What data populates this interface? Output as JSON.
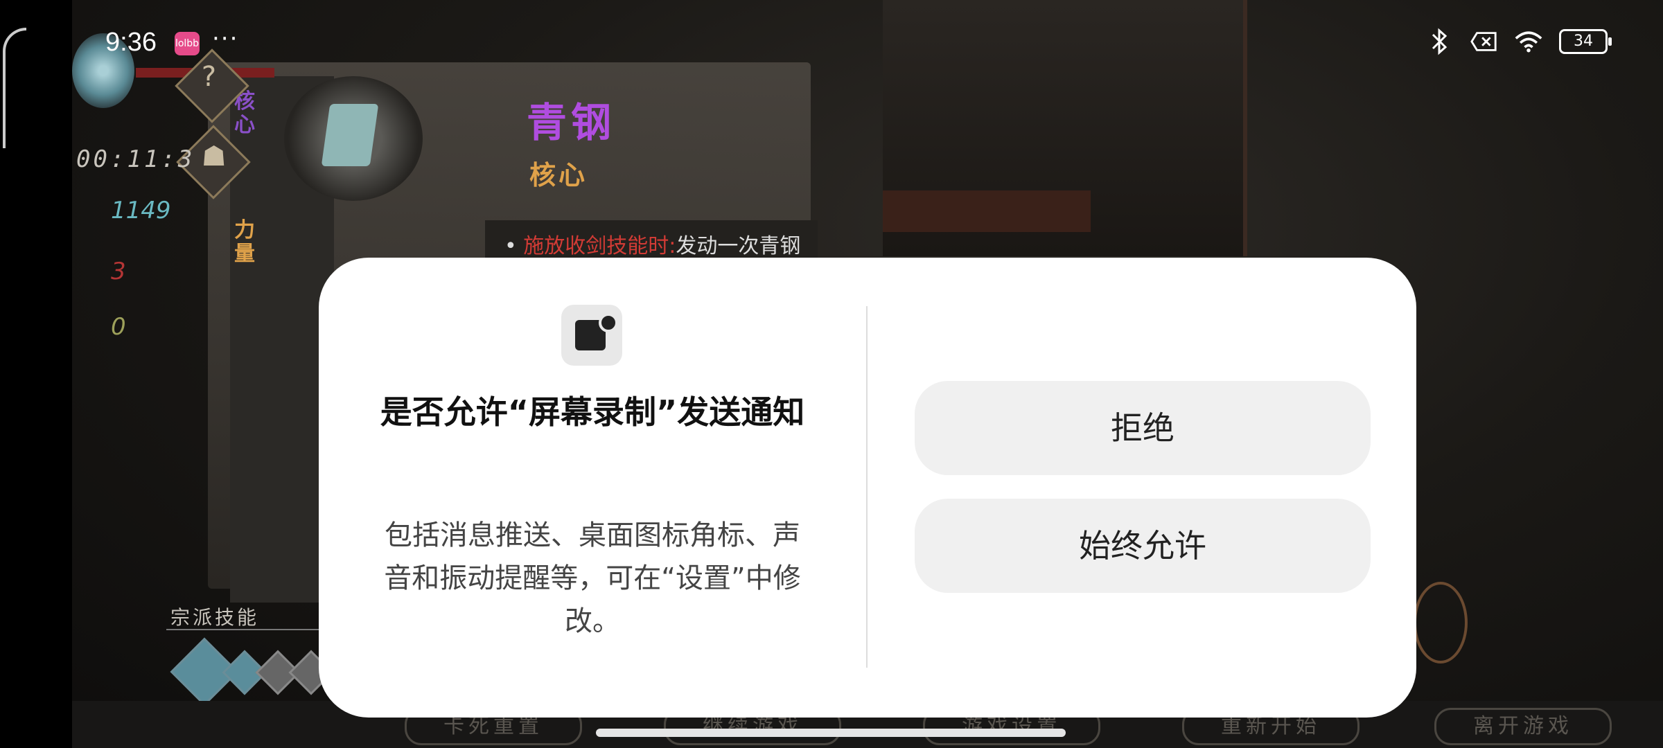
{
  "status_bar": {
    "time": "9:36",
    "app_badge": "lolbb",
    "more": "···",
    "battery": "34",
    "icons": [
      "bluetooth-icon",
      "close-box-icon",
      "wifi-icon",
      "battery-icon"
    ]
  },
  "game": {
    "item_title": "青钢",
    "item_subtitle": "核心",
    "side_tab_1": "核心",
    "side_tab_2": "力量",
    "item_desc_highlight": "施放收剑技能时:",
    "item_desc_rest": "发动一次青钢",
    "timer": "00:11:3",
    "stat_1": "1149",
    "stat_2": "3",
    "stat_3": "0",
    "help_glyph": "?",
    "skill_label": "宗派技能",
    "bottom_buttons": [
      "卡死重置",
      "继续游戏",
      "游戏设置",
      "重新开始",
      "离开游戏"
    ]
  },
  "dialog": {
    "title": "是否允许“屏幕录制”发送通知",
    "body": "包括消息推送、桌面图标角标、声音和振动提醒等，可在“设置”中修改。",
    "deny_label": "拒绝",
    "allow_label": "始终允许"
  },
  "colors": {
    "dialog_bg": "#ffffff",
    "button_bg": "#f0f0f0",
    "item_title": "#b04de0",
    "item_subtitle": "#e0a24a"
  }
}
